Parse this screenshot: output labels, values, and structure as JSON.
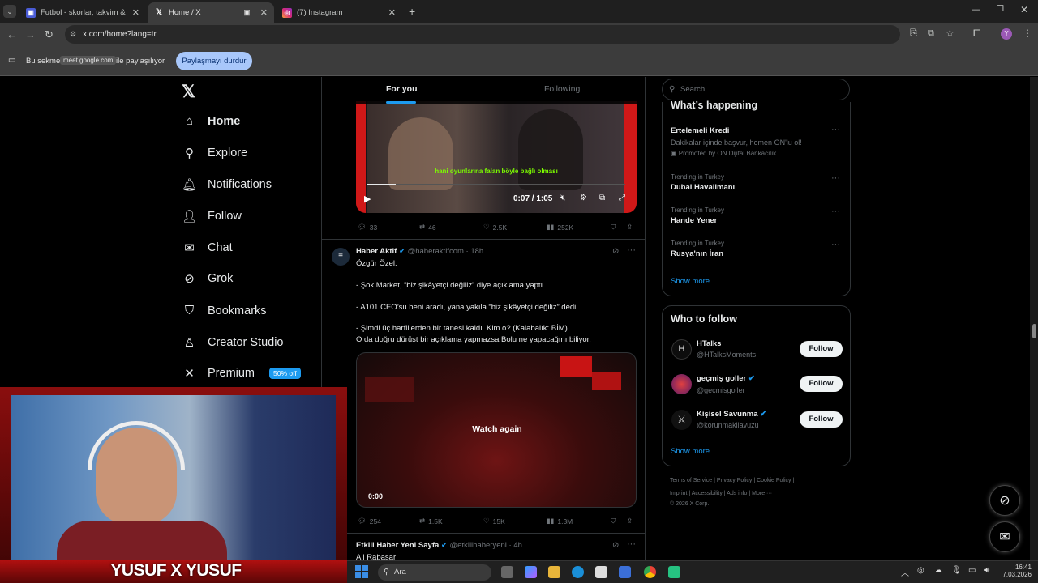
{
  "browser": {
    "tabs": [
      {
        "title": "Futbol - skorlar, takvim & oran..."
      },
      {
        "title": "Home / X"
      },
      {
        "title": "(7) Instagram"
      }
    ],
    "url": "x.com/home?lang=tr",
    "share_text_before": "Bu sekme",
    "share_chip": "meet.google.com",
    "share_text_after": "ile paylaşılıyor",
    "stop_share": "Paylaşmayı durdur"
  },
  "nav": {
    "items": [
      {
        "label": "Home",
        "icon": "home-icon"
      },
      {
        "label": "Explore",
        "icon": "search-icon"
      },
      {
        "label": "Notifications",
        "icon": "bell-icon"
      },
      {
        "label": "Follow",
        "icon": "add-person-icon"
      },
      {
        "label": "Chat",
        "icon": "mail-icon"
      },
      {
        "label": "Grok",
        "icon": "grok-icon"
      },
      {
        "label": "Bookmarks",
        "icon": "bookmark-icon"
      },
      {
        "label": "Creator Studio",
        "icon": "creator-icon"
      },
      {
        "label": "Premium",
        "icon": "x-icon"
      }
    ],
    "premium_badge": "50% off"
  },
  "feed": {
    "tabs": [
      "For you",
      "Following"
    ],
    "video1": {
      "subtitle": "hani oyunlarına falan böyle bağlı olması",
      "time": "0:07 / 1:05",
      "progress_fraction": 0.11,
      "stats": {
        "replies": "33",
        "reposts": "46",
        "likes": "2.5K",
        "views": "252K"
      }
    },
    "tweet2": {
      "name": "Haber Aktif",
      "handle": "@haberaktifcom",
      "time": "· 18h",
      "lines": [
        "Özgür Özel:",
        "- Şok Market, “biz şikâyetçi değiliz” diye açıklama yaptı.",
        "- A101 CEO’su beni aradı, yana yakıla “biz şikâyetçi değiliz” dedi.",
        "- Şimdi üç harfillerden bir tanesi kaldı. Kim o? (Kalabalık: BİM)",
        "O da doğru dürüst bir açıklama yapmazsa Bolu ne yapacağını biliyor."
      ],
      "watch_again": "Watch again",
      "video_time": "0:00",
      "stats": {
        "replies": "254",
        "reposts": "1.5K",
        "likes": "15K",
        "views": "1.3M"
      }
    },
    "tweet3": {
      "name": "Etkili Haber Yeni Sayfa",
      "handle": "@etkilihaberyeni",
      "time": "· 4h",
      "preview": "All Rabasar"
    }
  },
  "right": {
    "search_placeholder": "Search",
    "happening_title": "What’s happening",
    "trends": [
      {
        "meta": "",
        "title": "Ertelemeli Kredi",
        "desc": "Dakikalar içinde başvur, hemen ON'lu ol!",
        "promo": "Promoted by ON Dijital Bankacılık"
      },
      {
        "meta": "Trending in Turkey",
        "title": "Dubai Havalimanı"
      },
      {
        "meta": "Trending in Turkey",
        "title": "Hande Yener"
      },
      {
        "meta": "Trending in Turkey",
        "title": "Rusya'nın İran"
      }
    ],
    "show_more": "Show more",
    "who_title": "Who to follow",
    "who": [
      {
        "name": "HTalks",
        "handle": "@HTalksMoments",
        "button": "Follow"
      },
      {
        "name": "geçmiş goller",
        "handle": "@gecmisgoller",
        "button": "Follow"
      },
      {
        "name": "Kişisel Savunma",
        "handle": "@korunmakilavuzu",
        "button": "Follow"
      }
    ],
    "who_show_more": "Show more",
    "footer1": "Terms of Service  |  Privacy Policy  |  Cookie Policy  |",
    "footer2": "Imprint  |  Accessibility  |  Ads info  |  More ···",
    "footer3": "© 2026 X Corp."
  },
  "webcam": {
    "banner": "YUSUF X YUSUF"
  },
  "taskbar": {
    "search_label": "Ara",
    "time": "16:41",
    "date": "7.03.2026"
  },
  "colors": {
    "accent": "#1d9bf0",
    "bg": "#000000",
    "stream_red": "#c01818"
  }
}
